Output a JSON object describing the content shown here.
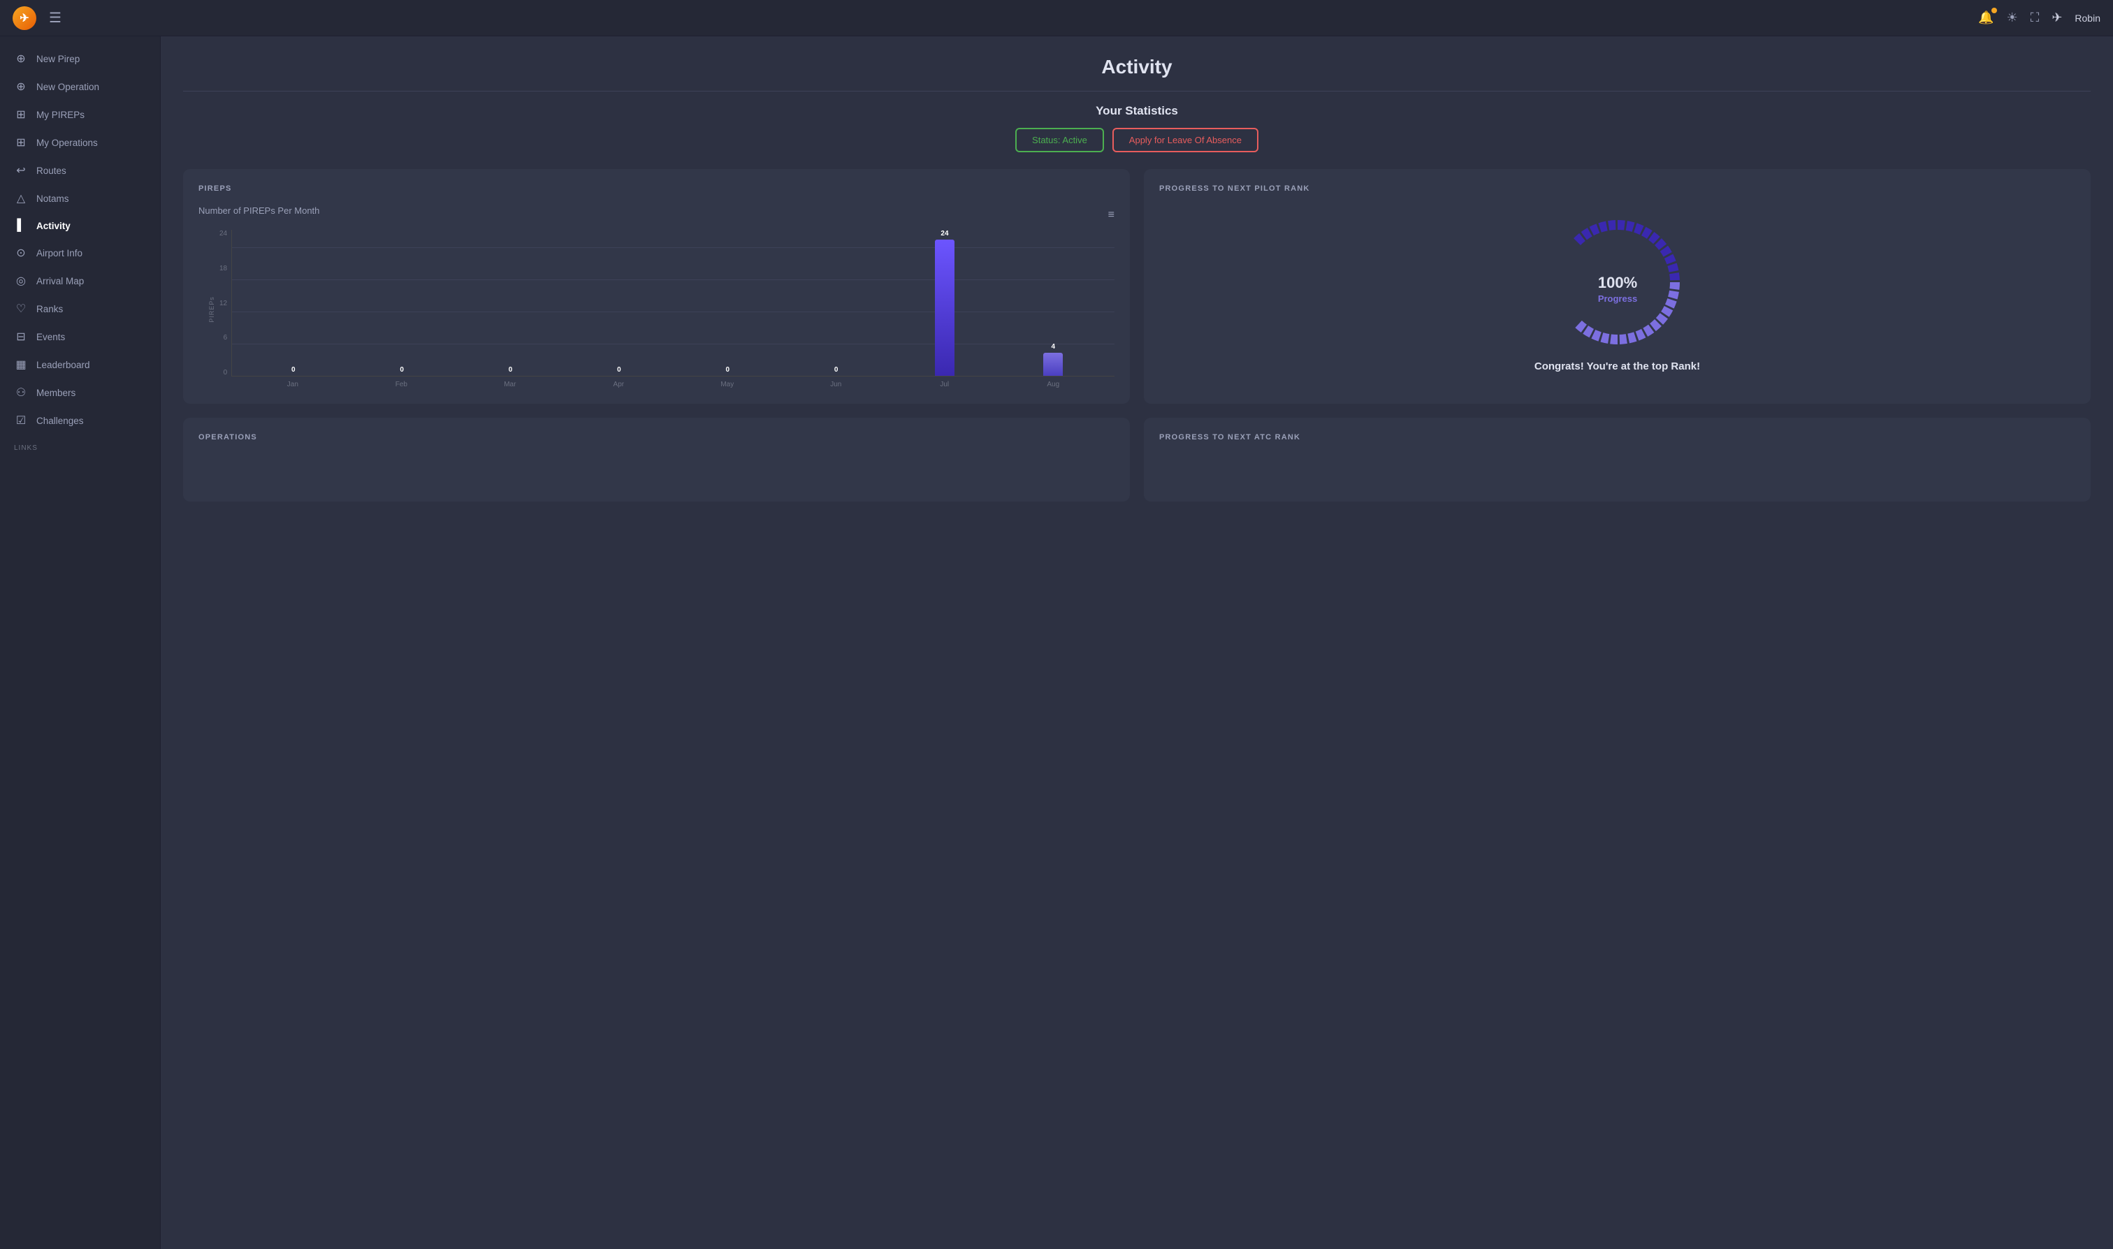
{
  "app": {
    "logo_text": "✈",
    "user_name": "Robin"
  },
  "topnav": {
    "bell_icon": "🔔",
    "sun_icon": "☀",
    "fullscreen_icon": "⛶",
    "plane_icon": "✈"
  },
  "sidebar": {
    "items": [
      {
        "id": "new-pirep",
        "label": "New Pirep",
        "icon": "⊕",
        "active": false
      },
      {
        "id": "new-operation",
        "label": "New Operation",
        "icon": "⊕",
        "active": false
      },
      {
        "id": "my-pireps",
        "label": "My PIREPs",
        "icon": "⊞",
        "active": false
      },
      {
        "id": "my-operations",
        "label": "My Operations",
        "icon": "⊞",
        "active": false
      },
      {
        "id": "routes",
        "label": "Routes",
        "icon": "↩",
        "active": false
      },
      {
        "id": "notams",
        "label": "Notams",
        "icon": "△",
        "active": false
      },
      {
        "id": "activity",
        "label": "Activity",
        "icon": "▌",
        "active": true
      },
      {
        "id": "airport-info",
        "label": "Airport Info",
        "icon": "⊙",
        "active": false
      },
      {
        "id": "arrival-map",
        "label": "Arrival Map",
        "icon": "◎",
        "active": false
      },
      {
        "id": "ranks",
        "label": "Ranks",
        "icon": "♡",
        "active": false
      },
      {
        "id": "events",
        "label": "Events",
        "icon": "⊟",
        "active": false
      },
      {
        "id": "leaderboard",
        "label": "Leaderboard",
        "icon": "▦",
        "active": false
      },
      {
        "id": "members",
        "label": "Members",
        "icon": "⚇",
        "active": false
      },
      {
        "id": "challenges",
        "label": "Challenges",
        "icon": "☑",
        "active": false
      }
    ],
    "links_label": "LINKS"
  },
  "main": {
    "page_title": "Activity",
    "stats_title": "Your Statistics",
    "status_btn": "Status: Active",
    "leave_btn": "Apply for Leave Of Absence",
    "pireps_card": {
      "label": "PIREPS",
      "chart_title": "Number of PIREPs Per Month",
      "y_title": "PIREPs",
      "y_labels": [
        "24",
        "18",
        "12",
        "6",
        "0"
      ],
      "bars": [
        {
          "month": "Jan",
          "value": 0
        },
        {
          "month": "Feb",
          "value": 0
        },
        {
          "month": "Mar",
          "value": 0
        },
        {
          "month": "Apr",
          "value": 0
        },
        {
          "month": "May",
          "value": 0
        },
        {
          "month": "Jun",
          "value": 0
        },
        {
          "month": "Jul",
          "value": 24,
          "highlight": true
        },
        {
          "month": "Aug",
          "value": 4
        }
      ],
      "max_value": 24
    },
    "progress_card": {
      "label": "PROGRESS TO NEXT PILOT RANK",
      "percent": 100,
      "percent_label": "100%",
      "sub_label": "Progress",
      "congrats": "Congrats! You're at the top Rank!"
    },
    "operations_card": {
      "label": "OPERATIONS"
    },
    "atc_card": {
      "label": "PROGRESS TO NEXT ATC RANK"
    }
  }
}
